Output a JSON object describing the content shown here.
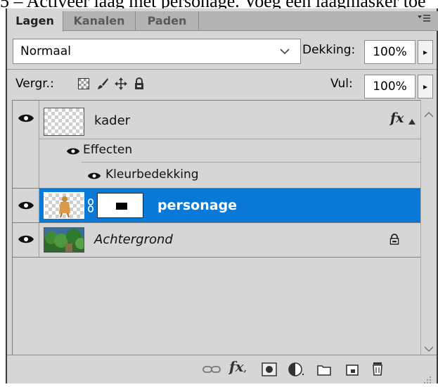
{
  "caption": "5 – Activeer laag met personage. Voeg een laagmasker toe",
  "tabs": [
    {
      "label": "Lagen",
      "active": true
    },
    {
      "label": "Kanalen",
      "active": false
    },
    {
      "label": "Paden",
      "active": false
    }
  ],
  "blend_mode": {
    "value": "Normaal"
  },
  "opacity": {
    "label": "Dekking:",
    "value": "100%"
  },
  "lock": {
    "label": "Vergr.:"
  },
  "fill": {
    "label": "Vul:",
    "value": "100%"
  },
  "layers": {
    "kader": {
      "name": "kader",
      "fx_label": "fx"
    },
    "effects_label": "Effecten",
    "effect_item": "Kleurbedekking",
    "personage": {
      "name": "personage"
    },
    "achtergrond": {
      "name": "Achtergrond"
    }
  },
  "colors": {
    "panel_bg": "#d6d6d6",
    "selected_row": "#0a78d7",
    "tab_strip": "#b3b3b3"
  },
  "icons": [
    "eye-icon",
    "link-icon",
    "fx-icon",
    "mask-icon",
    "adjustment-icon",
    "folder-icon",
    "new-layer-icon",
    "trash-icon",
    "lock-icon"
  ]
}
